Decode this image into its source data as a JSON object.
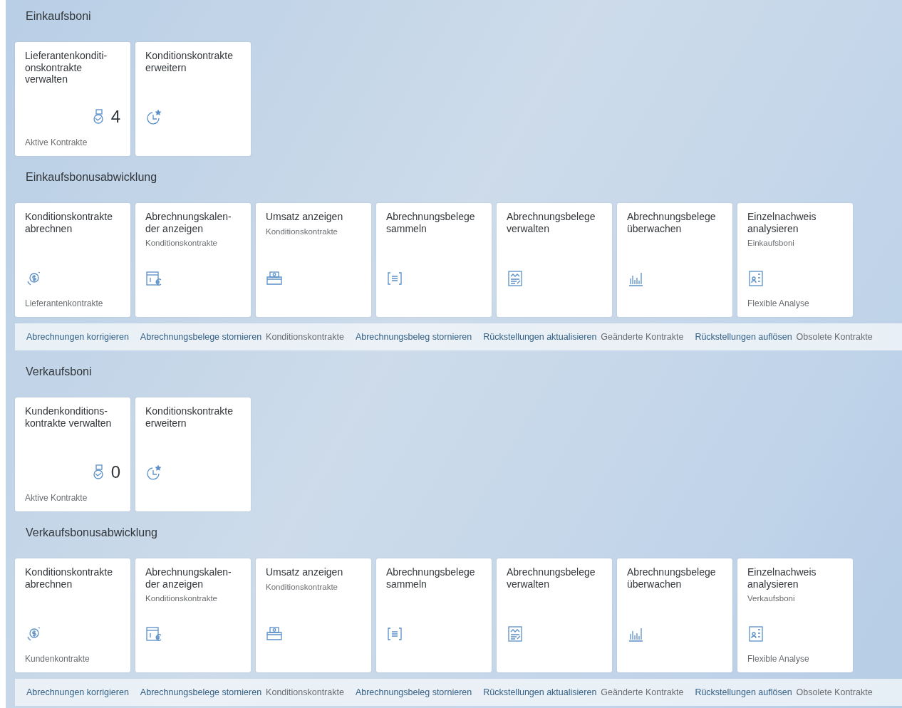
{
  "groups": [
    {
      "title": "Einkaufsboni",
      "tiles": [
        {
          "title": "Lieferantenkonditi-onskontrakte verwalten",
          "kind": "contract",
          "number": "4",
          "footer": "Aktive Kontrakte"
        },
        {
          "title": "Konditionskontrakte erweitern",
          "kind": "clockstar"
        }
      ]
    },
    {
      "title": "Einkaufsbonusabwicklung",
      "tiles": [
        {
          "title": "Konditionskontrakte abrechnen",
          "kind": "money",
          "footer": "Lieferantenkontrakte"
        },
        {
          "title": "Abrechnungskalen-der anzeigen",
          "subtitle": "Konditionskontrakte",
          "kind": "calendar"
        },
        {
          "title": "Umsatz anzeigen",
          "subtitle": "Konditionskontrakte",
          "kind": "cashbox"
        },
        {
          "title": "Abrechnungsbelege sammeln",
          "kind": "list"
        },
        {
          "title": "Abrechnungsbelege verwalten",
          "kind": "docchart"
        },
        {
          "title": "Abrechnungsbelege überwachen",
          "kind": "barchart"
        },
        {
          "title": "Einzelnachweis analysieren",
          "subtitle": "Einkaufsboni",
          "kind": "persondoc",
          "footer": "Flexible Analyse"
        }
      ],
      "links": [
        {
          "title": "Abrechnungen korrigieren"
        },
        {
          "title": "Abrechnungsbelege stornieren",
          "subtitle": "Konditionskontrakte"
        },
        {
          "title": "Abrechnungsbeleg stornieren"
        },
        {
          "title": "Rückstellungen aktualisieren",
          "subtitle": "Geänderte Kontrakte"
        },
        {
          "title": "Rückstellungen auflösen",
          "subtitle": "Obsolete Kontrakte"
        }
      ]
    },
    {
      "title": "Verkaufsboni",
      "tiles": [
        {
          "title": "Kundenkonditions-kontrakte verwalten",
          "kind": "contract",
          "number": "0",
          "footer": "Aktive Kontrakte"
        },
        {
          "title": "Konditionskontrakte erweitern",
          "kind": "clockstar"
        }
      ]
    },
    {
      "title": "Verkaufsbonusabwicklung",
      "tiles": [
        {
          "title": "Konditionskontrakte abrechnen",
          "kind": "money",
          "footer": "Kundenkontrakte"
        },
        {
          "title": "Abrechnungskalen-der anzeigen",
          "subtitle": "Konditionskontrakte",
          "kind": "calendar"
        },
        {
          "title": "Umsatz anzeigen",
          "subtitle": "Konditionskontrakte",
          "kind": "cashbox"
        },
        {
          "title": "Abrechnungsbelege sammeln",
          "kind": "list"
        },
        {
          "title": "Abrechnungsbelege verwalten",
          "kind": "docchart"
        },
        {
          "title": "Abrechnungsbelege überwachen",
          "kind": "barchart"
        },
        {
          "title": "Einzelnachweis analysieren",
          "subtitle": "Verkaufsboni",
          "kind": "persondoc",
          "footer": "Flexible Analyse"
        }
      ],
      "links": [
        {
          "title": "Abrechnungen korrigieren"
        },
        {
          "title": "Abrechnungsbelege stornieren",
          "subtitle": "Konditionskontrakte"
        },
        {
          "title": "Abrechnungsbeleg stornieren"
        },
        {
          "title": "Rückstellungen aktualisieren",
          "subtitle": "Geänderte Kontrakte"
        },
        {
          "title": "Rückstellungen auflösen",
          "subtitle": "Obsolete Kontrakte"
        }
      ]
    }
  ]
}
